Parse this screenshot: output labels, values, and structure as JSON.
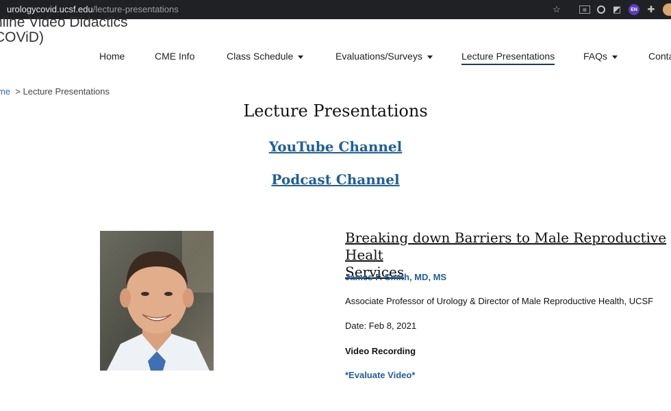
{
  "browser": {
    "url_host": "urologycovid.ucsf.edu",
    "url_path": "/lecture-presentations",
    "icons": [
      "star-icon",
      "extension-grid-icon",
      "circle-extension-icon",
      "leaf-extension-icon",
      "translate-extension-icon",
      "puzzle-icon",
      "profile-avatar"
    ],
    "translate_label": "EN",
    "bar_color": "#202124"
  },
  "site": {
    "title_line1": "nline Video Didactics",
    "title_line2": "COViD)"
  },
  "nav": {
    "items": [
      {
        "label": "Home"
      },
      {
        "label": "CME Info"
      },
      {
        "label": "Class Schedule"
      },
      {
        "label": "Evaluations/Surveys"
      },
      {
        "label": "Lecture Presentations"
      },
      {
        "label": "FAQs"
      },
      {
        "label": "Conta"
      }
    ]
  },
  "breadcrumb": {
    "home": "me",
    "separator": ">",
    "current": "Lecture Presentations"
  },
  "page": {
    "title": "Lecture Presentations",
    "youtube_link": "YouTube Channel",
    "podcast_link": "Podcast Channel"
  },
  "lecture": {
    "title": "Breaking down Barriers to Male Reproductive Healt Services",
    "title_line1": "Breaking down Barriers to Male Reproductive Healt",
    "title_line2": "Services",
    "speaker": "James F. Smith, MD, MS",
    "affiliation": "Associate Professor of Urology & Director of Male Reproductive Health, UCSF",
    "date": "Date: Feb 8, 2021",
    "video_label": "Video Recording",
    "evaluate_label": "*Evaluate Video*"
  },
  "colors": {
    "link_blue": "#1f5f9a",
    "active_underline": "#1f3a4d"
  }
}
